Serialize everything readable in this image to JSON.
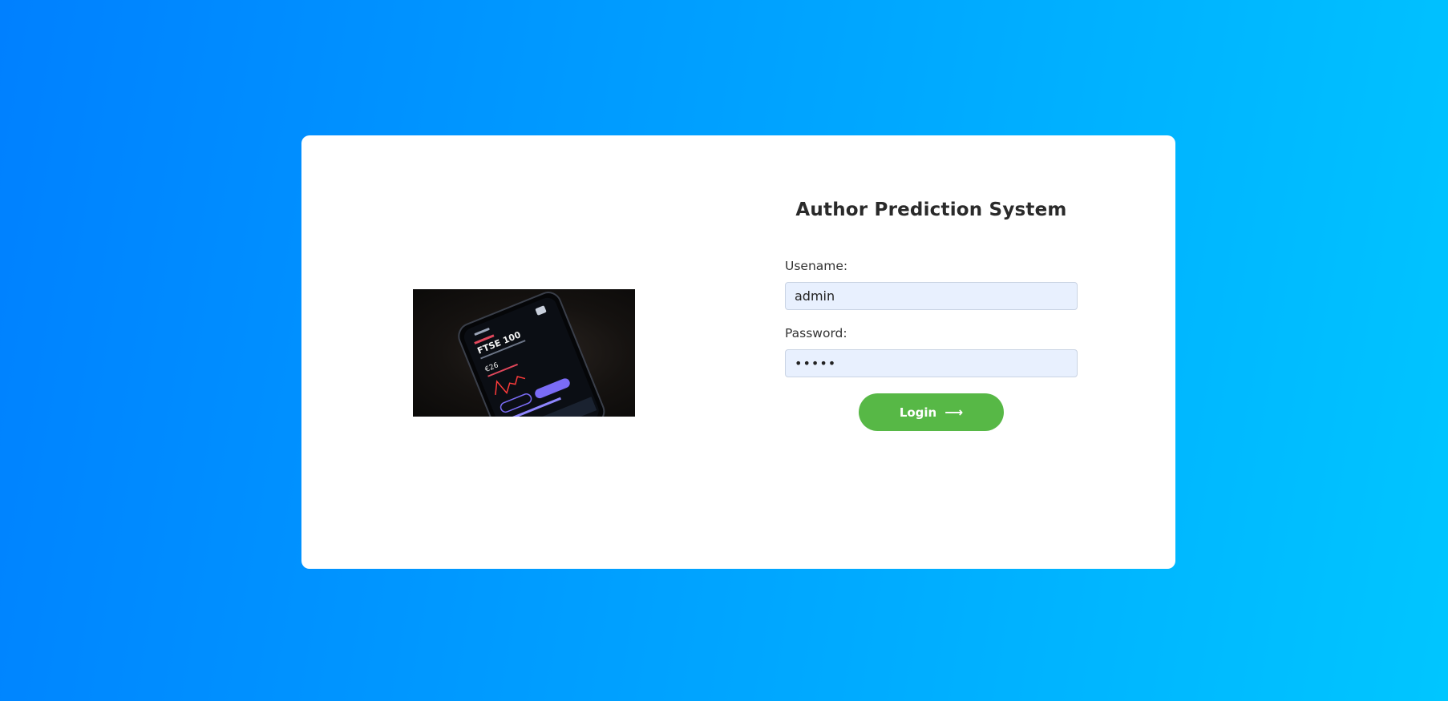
{
  "login": {
    "title": "Author Prediction System",
    "username_label": "Usename:",
    "username_value": "admin",
    "password_label": "Password:",
    "password_value": "•••••",
    "button_label": "Login",
    "button_icon": "arrow-right-icon"
  },
  "image": {
    "phone_title": "FTSE 100",
    "phone_value": "€26"
  },
  "colors": {
    "gradient_start": "#0080ff",
    "gradient_end": "#00c6ff",
    "card_background": "#ffffff",
    "input_background": "#e8f0fe",
    "button_background": "#57b846",
    "title_text": "#2a2a2a"
  }
}
